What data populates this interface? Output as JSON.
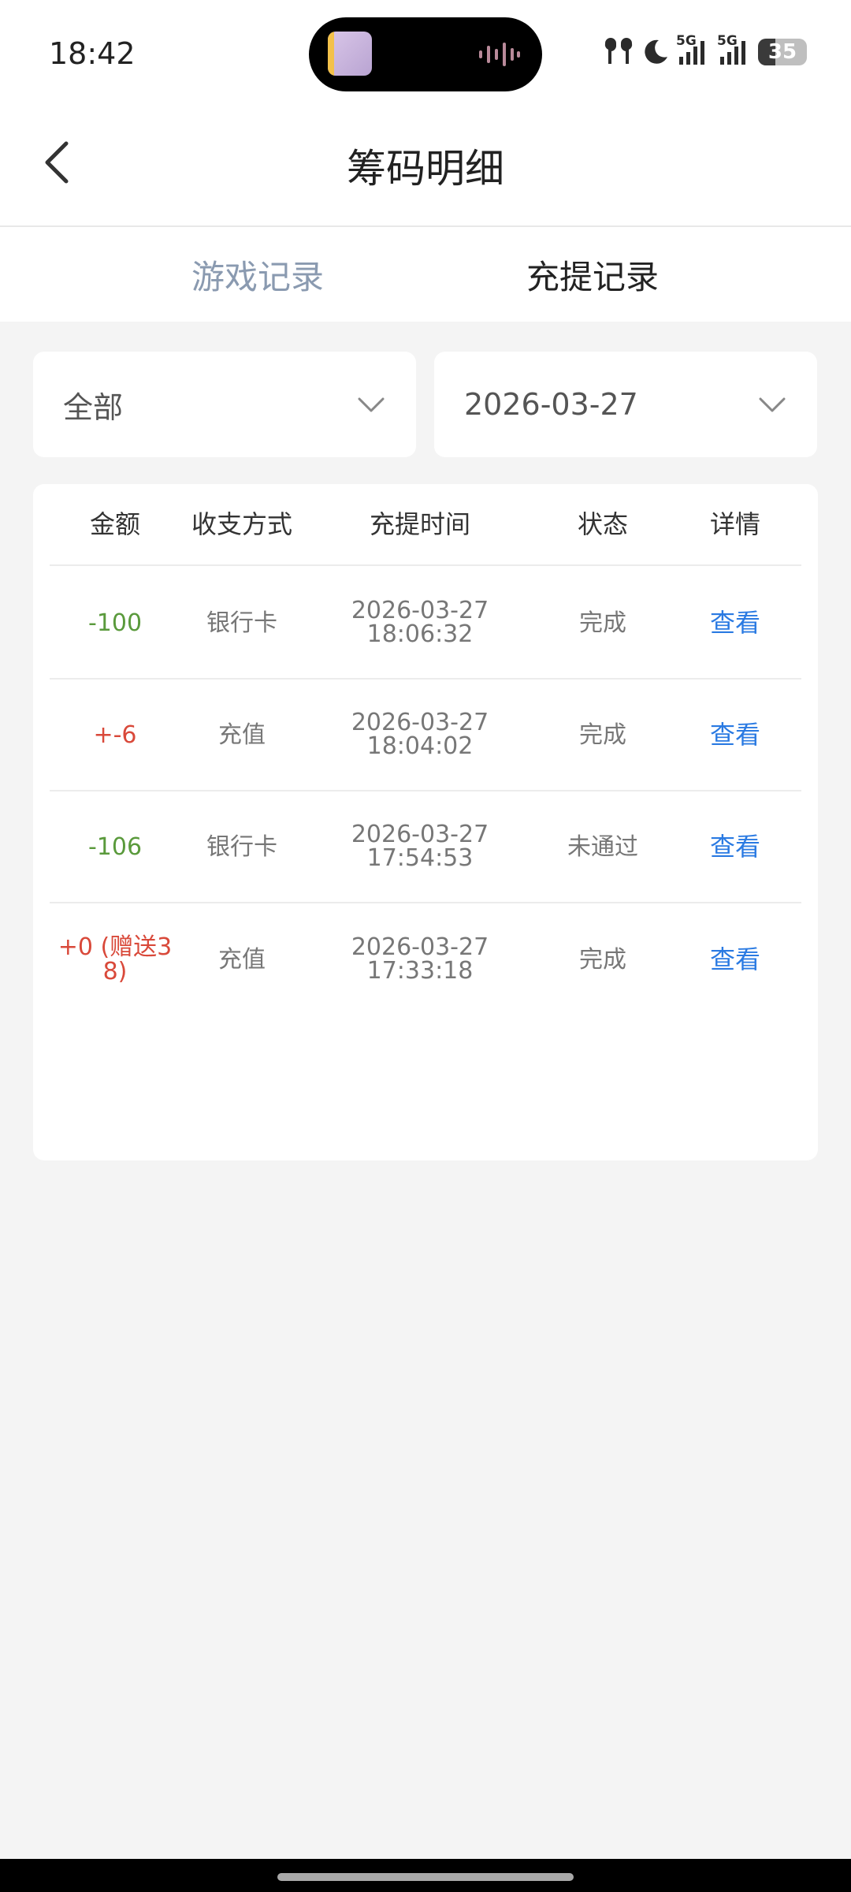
{
  "status_bar": {
    "time": "18:42",
    "battery": "35",
    "battery_level": 0.35,
    "network_1": "5G",
    "network_2": "5G",
    "icons": [
      "earbuds-icon",
      "moon-icon",
      "signal-5g-icon",
      "signal-5g-icon",
      "battery-icon"
    ]
  },
  "header": {
    "title": "筹码明细",
    "back_icon": "chevron-left-icon"
  },
  "tabs": [
    {
      "label": "游戏记录",
      "active": false
    },
    {
      "label": "充提记录",
      "active": true
    }
  ],
  "filters": {
    "type": {
      "value": "全部",
      "icon": "chevron-down-icon"
    },
    "date": {
      "value": "2026-03-27",
      "icon": "chevron-down-icon"
    }
  },
  "table": {
    "headers": [
      "金额",
      "收支方式",
      "充提时间",
      "状态",
      "详情"
    ],
    "rows": [
      {
        "amount_line1": "-100",
        "amount_line2": "",
        "amount_sign": "negative",
        "method": "银行卡",
        "date": "2026-03-27",
        "time": "18:06:32",
        "status": "完成",
        "detail": "查看"
      },
      {
        "amount_line1": "+-6",
        "amount_line2": "",
        "amount_sign": "positive",
        "method": "充值",
        "date": "2026-03-27",
        "time": "18:04:02",
        "status": "完成",
        "detail": "查看"
      },
      {
        "amount_line1": "-106",
        "amount_line2": "",
        "amount_sign": "negative",
        "method": "银行卡",
        "date": "2026-03-27",
        "time": "17:54:53",
        "status": "未通过",
        "detail": "查看"
      },
      {
        "amount_line1": "+0 (赠送3",
        "amount_line2": "8)",
        "amount_sign": "positive",
        "method": "充值",
        "date": "2026-03-27",
        "time": "17:33:18",
        "status": "完成",
        "detail": "查看"
      }
    ]
  },
  "colors": {
    "negative": "#5a9a3c",
    "positive": "#d9493a",
    "link": "#2a7ae2",
    "tab_inactive": "#8a9ab0",
    "background": "#f4f4f4"
  }
}
